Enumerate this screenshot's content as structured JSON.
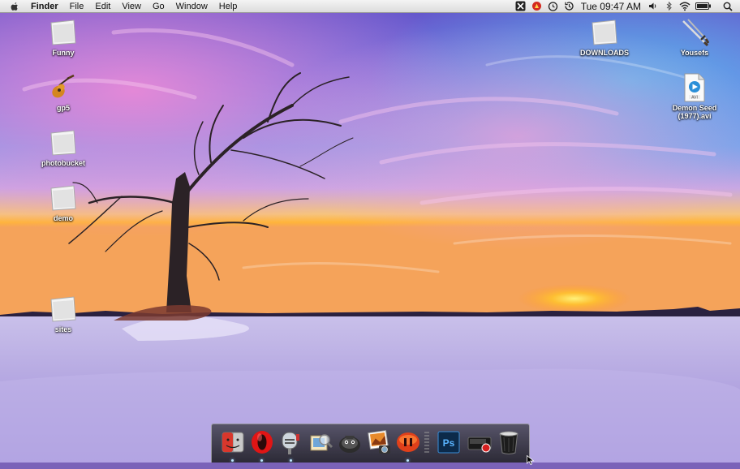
{
  "menubar": {
    "app_name": "Finder",
    "menus": [
      "File",
      "Edit",
      "View",
      "Go",
      "Window",
      "Help"
    ],
    "clock": "Tue 09:47 AM",
    "status_icons": [
      "crossover-icon",
      "alert-icon",
      "timer-icon",
      "time-machine-icon",
      "volume-icon",
      "bluetooth-icon",
      "wifi-icon",
      "battery-icon",
      "spotlight-icon"
    ]
  },
  "desktop": {
    "left_icons": [
      {
        "label": "Funny",
        "icon": "folder-icon"
      },
      {
        "label": "gp5",
        "icon": "guitar-icon"
      },
      {
        "label": "photobucket",
        "icon": "folder-icon"
      },
      {
        "label": "demo",
        "icon": "folder-icon"
      },
      {
        "label": "sites",
        "icon": "folder-icon"
      }
    ],
    "right_icons": [
      {
        "label": "DOWNLOADS",
        "icon": "folder-icon"
      },
      {
        "label": "Yousefs",
        "icon": "swords-icon"
      },
      {
        "label": "Demon Seed\n(1977).avi",
        "icon": "avi-file-icon"
      }
    ]
  },
  "dock": {
    "items": [
      {
        "name": "finder-icon",
        "running": true
      },
      {
        "name": "opera-icon",
        "running": true
      },
      {
        "name": "mail-icon",
        "running": true
      },
      {
        "name": "preview-icon",
        "running": false
      },
      {
        "name": "adium-icon",
        "running": false
      },
      {
        "name": "iphoto-icon",
        "running": false
      },
      {
        "name": "media-player-icon",
        "running": true
      },
      {
        "name": "photoshop-icon",
        "running": false
      },
      {
        "name": "recording-icon",
        "running": false
      },
      {
        "name": "trash-icon",
        "running": false
      }
    ],
    "photoshop_label": "Ps"
  },
  "colors": {
    "sky_top": "#6a57c9",
    "sky_pink": "#d977c9",
    "sky_blue": "#4f8ee6",
    "sunset": "#ffb43a",
    "snow": "#cfc6ee"
  }
}
